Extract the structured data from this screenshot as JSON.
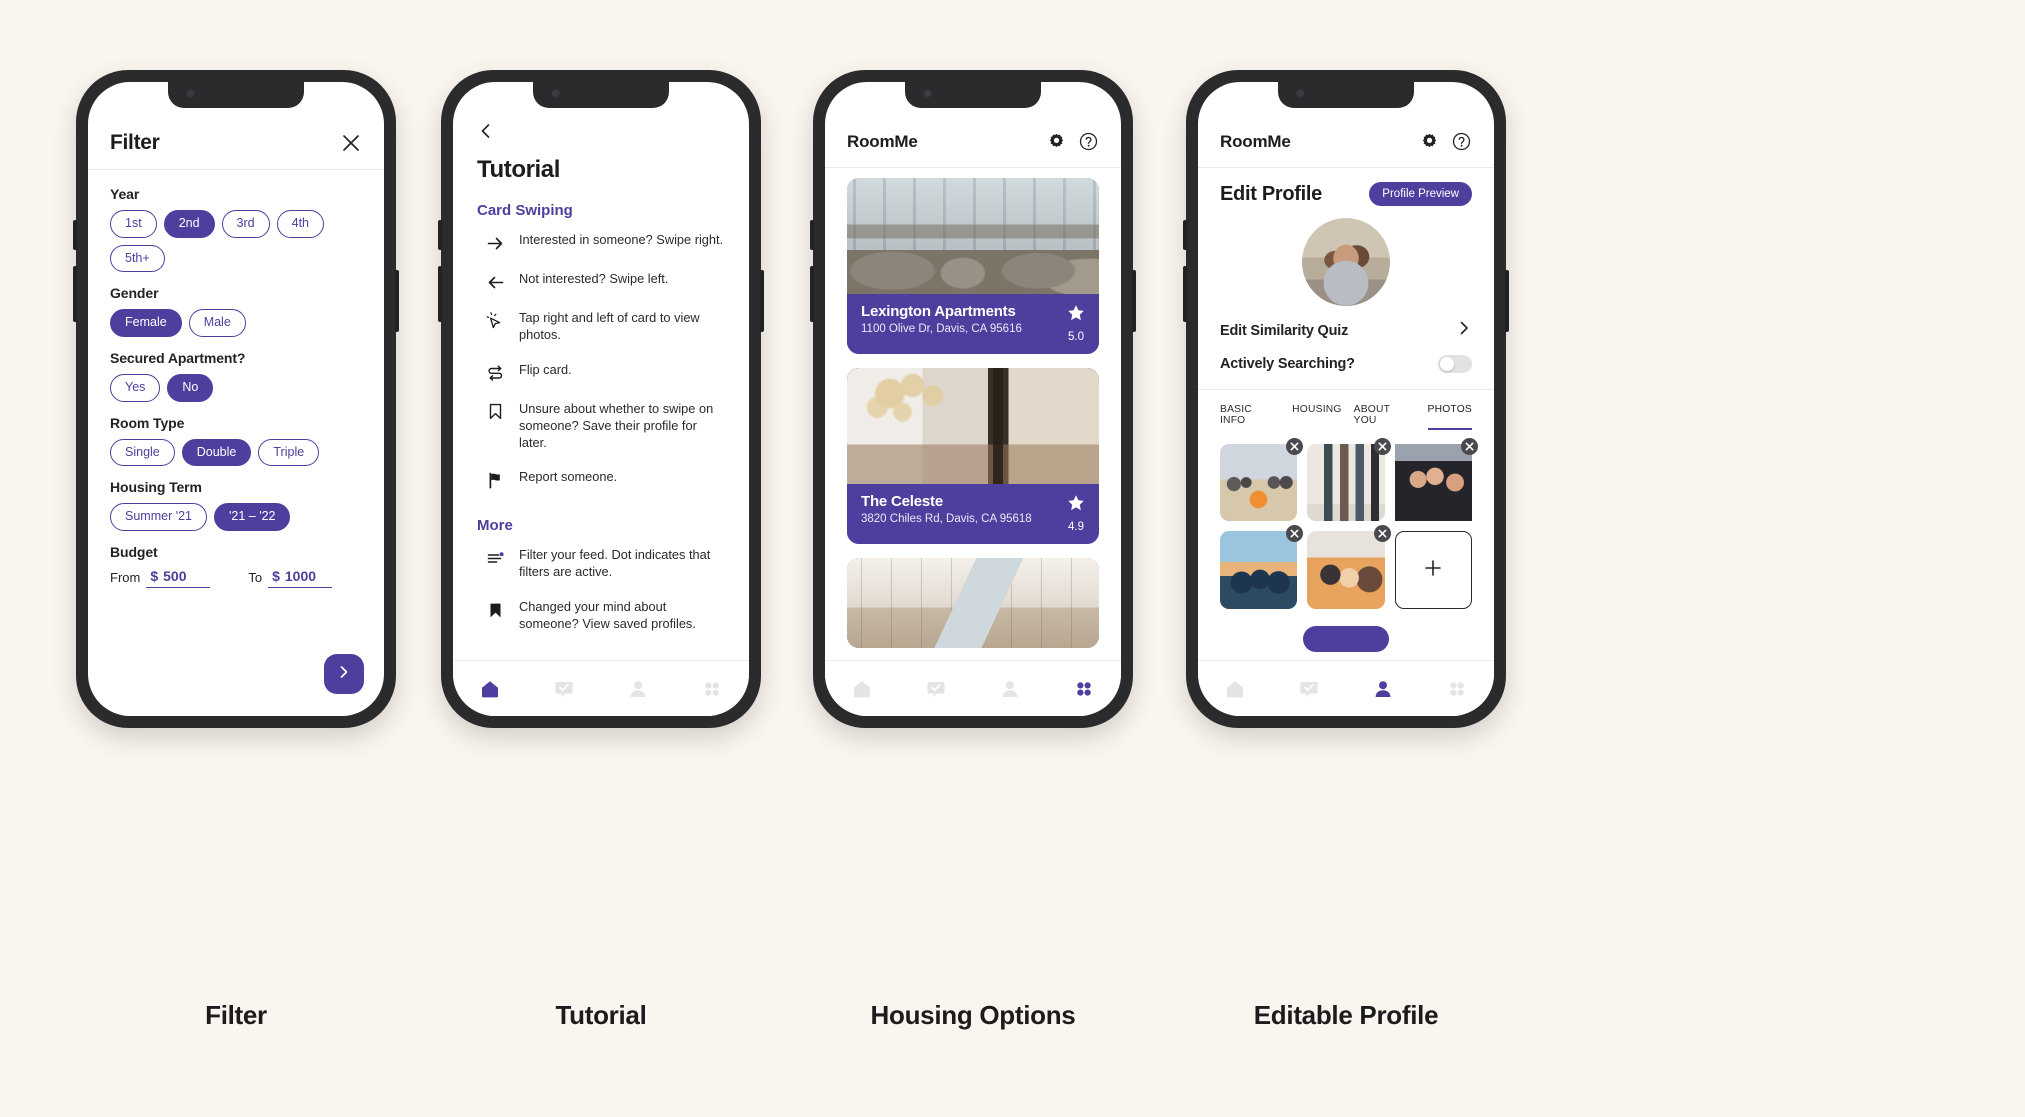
{
  "theme": {
    "accent": "#4e3f9e",
    "page_bg": "#faf5ee",
    "text": "#1c1c1e"
  },
  "captions": {
    "filter": "Filter",
    "tutorial": "Tutorial",
    "housing": "Housing Options",
    "profile": "Editable Profile"
  },
  "filter_screen": {
    "title": "Filter",
    "close_icon": "close-icon",
    "next_icon": "chevron-right-icon",
    "groups": [
      {
        "label": "Year",
        "options": [
          {
            "label": "1st",
            "selected": false
          },
          {
            "label": "2nd",
            "selected": true
          },
          {
            "label": "3rd",
            "selected": false
          },
          {
            "label": "4th",
            "selected": false
          },
          {
            "label": "5th+",
            "selected": false
          }
        ]
      },
      {
        "label": "Gender",
        "options": [
          {
            "label": "Female",
            "selected": true
          },
          {
            "label": "Male",
            "selected": false
          }
        ]
      },
      {
        "label": "Secured Apartment?",
        "options": [
          {
            "label": "Yes",
            "selected": false
          },
          {
            "label": "No",
            "selected": true
          }
        ]
      },
      {
        "label": "Room Type",
        "options": [
          {
            "label": "Single",
            "selected": false
          },
          {
            "label": "Double",
            "selected": true
          },
          {
            "label": "Triple",
            "selected": false
          }
        ]
      },
      {
        "label": "Housing Term",
        "options": [
          {
            "label": "Summer '21",
            "selected": false
          },
          {
            "label": "'21 – '22",
            "selected": true
          }
        ]
      }
    ],
    "budget": {
      "label": "Budget",
      "from_label": "From",
      "from_currency": "$",
      "from_value": "500",
      "to_label": "To",
      "to_currency": "$",
      "to_value": "1000"
    }
  },
  "tutorial_screen": {
    "back_icon": "chevron-left-icon",
    "title": "Tutorial",
    "sections": [
      {
        "heading": "Card Swiping",
        "items": [
          {
            "icon": "arrow-right-icon",
            "text": "Interested in someone? Swipe right."
          },
          {
            "icon": "arrow-left-icon",
            "text": "Not interested? Swipe left."
          },
          {
            "icon": "cursor-click-icon",
            "text": "Tap right and left of card to view photos."
          },
          {
            "icon": "flip-card-icon",
            "text": "Flip card."
          },
          {
            "icon": "bookmark-outline-icon",
            "text": "Unsure about whether to swipe on someone? Save their profile for later."
          },
          {
            "icon": "flag-icon",
            "text": "Report someone."
          }
        ]
      },
      {
        "heading": "More",
        "items": [
          {
            "icon": "filter-dot-icon",
            "text": "Filter your feed. Dot indicates that filters are active."
          },
          {
            "icon": "bookmark-filled-icon",
            "text": "Changed your mind about someone? View saved profiles."
          }
        ]
      }
    ],
    "nav": [
      {
        "icon": "home-icon",
        "active": true
      },
      {
        "icon": "message-check-icon",
        "active": false
      },
      {
        "icon": "person-icon",
        "active": false
      },
      {
        "icon": "grid-icon",
        "active": false
      }
    ]
  },
  "housing_screen": {
    "brand": "RoomMe",
    "settings_icon": "gear-icon",
    "help_icon": "help-circle-icon",
    "cards": [
      {
        "name": "Lexington Apartments",
        "address": "1100 Olive Dr, Davis, CA 95616",
        "rating": "5.0",
        "rating_icon": "star-icon",
        "image": "apartment-lounge-photo"
      },
      {
        "name": "The Celeste",
        "address": "3820 Chiles Rd, Davis, CA 95618",
        "rating": "4.9",
        "rating_icon": "star-icon",
        "image": "apartment-lobby-photo"
      },
      {
        "name": "",
        "address": "",
        "rating": "",
        "rating_icon": "star-icon",
        "image": "apartment-atrium-photo"
      }
    ],
    "nav": [
      {
        "icon": "home-icon",
        "active": false
      },
      {
        "icon": "message-check-icon",
        "active": false
      },
      {
        "icon": "person-icon",
        "active": false
      },
      {
        "icon": "grid-icon",
        "active": true
      }
    ]
  },
  "profile_screen": {
    "brand": "RoomMe",
    "settings_icon": "gear-icon",
    "help_icon": "help-circle-icon",
    "title": "Edit Profile",
    "preview_button": "Profile Preview",
    "avatar": "user-avatar",
    "rows": [
      {
        "label": "Edit Similarity Quiz",
        "control": "chevron-right-icon"
      },
      {
        "label": "Actively Searching?",
        "control": "toggle-off"
      }
    ],
    "tabs": [
      {
        "label": "BASIC INFO",
        "active": false
      },
      {
        "label": "HOUSING",
        "active": false
      },
      {
        "label": "ABOUT YOU",
        "active": false
      },
      {
        "label": "PHOTOS",
        "active": true
      }
    ],
    "photos": [
      {
        "name": "beach-bonfire-photo",
        "remove_icon": "remove-x-icon"
      },
      {
        "name": "friends-standing-photo",
        "remove_icon": "remove-x-icon"
      },
      {
        "name": "friends-street-photo",
        "remove_icon": "remove-x-icon"
      },
      {
        "name": "sunset-arms-up-photo",
        "remove_icon": "remove-x-icon"
      },
      {
        "name": "friends-laughing-photo",
        "remove_icon": "remove-x-icon"
      }
    ],
    "add_photo_icon": "plus-icon",
    "nav": [
      {
        "icon": "home-icon",
        "active": false
      },
      {
        "icon": "message-check-icon",
        "active": false
      },
      {
        "icon": "person-icon",
        "active": true
      },
      {
        "icon": "grid-icon",
        "active": false
      }
    ]
  }
}
